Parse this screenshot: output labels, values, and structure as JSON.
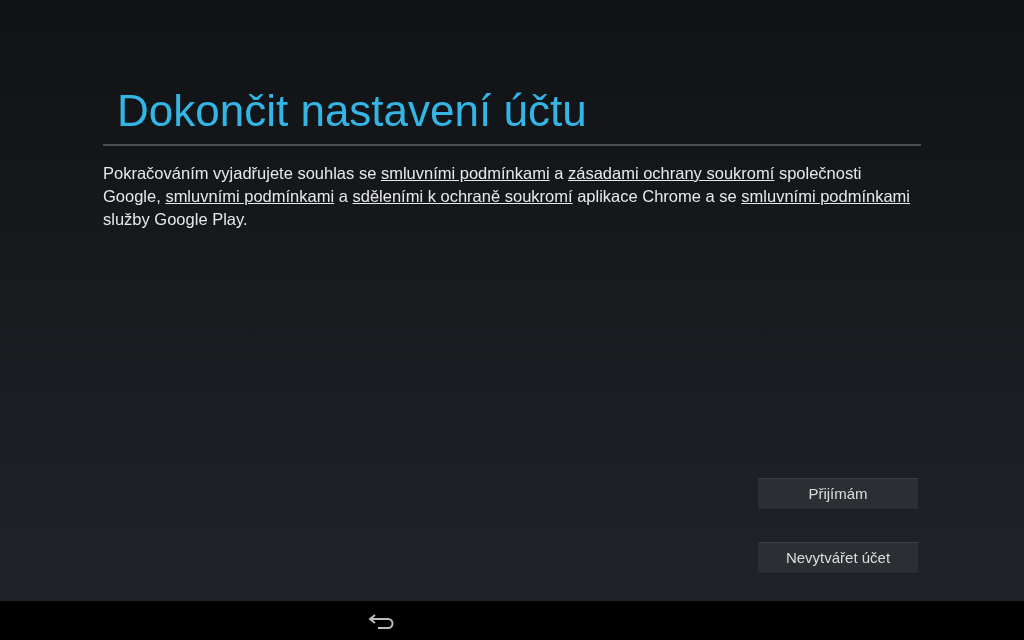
{
  "title": "Dokončit nastavení účtu",
  "agreement": [
    {
      "kind": "text",
      "text": "Pokračováním vyjadřujete souhlas se "
    },
    {
      "kind": "link",
      "text": "smluvními podmínkami"
    },
    {
      "kind": "text",
      "text": " a "
    },
    {
      "kind": "link",
      "text": "zásadami ochrany soukromí"
    },
    {
      "kind": "text",
      "text": " společnosti Google, "
    },
    {
      "kind": "link",
      "text": "smluvními podmínkami"
    },
    {
      "kind": "text",
      "text": " a "
    },
    {
      "kind": "link",
      "text": "sděleními k ochraně soukromí"
    },
    {
      "kind": "text",
      "text": " aplikace Chrome a se "
    },
    {
      "kind": "link",
      "text": "smluvními podmínkami"
    },
    {
      "kind": "text",
      "text": " služby Google Play."
    }
  ],
  "buttons": [
    "Přijímám",
    "Nevytvářet účet"
  ]
}
